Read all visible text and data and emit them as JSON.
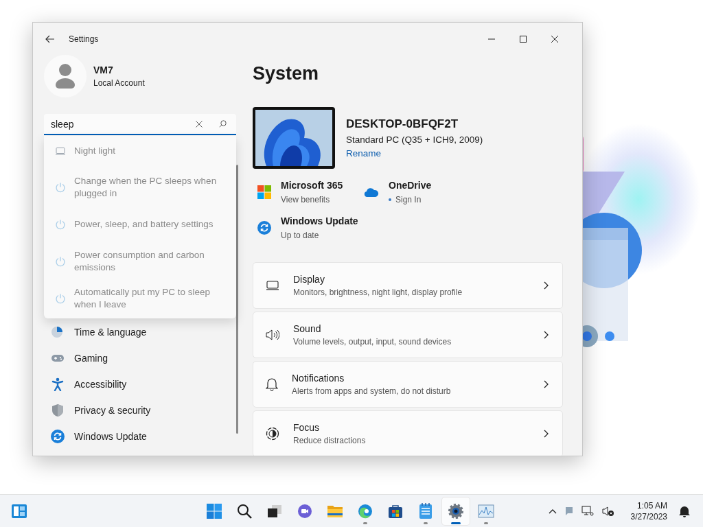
{
  "window": {
    "title": "Settings"
  },
  "account": {
    "name": "VM7",
    "type": "Local Account"
  },
  "search": {
    "value": "sleep"
  },
  "search_results": [
    {
      "kind": "display",
      "label": "Night light"
    },
    {
      "kind": "power",
      "label": "Change when the PC sleeps when plugged in"
    },
    {
      "kind": "power",
      "label": "Power, sleep, and battery settings"
    },
    {
      "kind": "power",
      "label": "Power consumption and carbon emissions"
    },
    {
      "kind": "power",
      "label": "Automatically put my PC to sleep when I leave"
    }
  ],
  "sidebar": {
    "items": [
      {
        "kind": "time",
        "label": "Time & language"
      },
      {
        "kind": "gaming",
        "label": "Gaming"
      },
      {
        "kind": "accessibility",
        "label": "Accessibility"
      },
      {
        "kind": "privacy",
        "label": "Privacy & security"
      },
      {
        "kind": "update",
        "label": "Windows Update"
      }
    ]
  },
  "page": {
    "title": "System"
  },
  "device": {
    "name": "DESKTOP-0BFQF2T",
    "model": "Standard PC (Q35 + ICH9, 2009)",
    "action": "Rename"
  },
  "services": [
    {
      "kind": "m365",
      "title": "Microsoft 365",
      "subtitle": "View benefits"
    },
    {
      "kind": "onedrive",
      "title": "OneDrive",
      "subtitle": "Sign In"
    },
    {
      "kind": "update",
      "title": "Windows Update",
      "subtitle": "Up to date"
    }
  ],
  "categories": [
    {
      "kind": "display",
      "title": "Display",
      "subtitle": "Monitors, brightness, night light, display profile"
    },
    {
      "kind": "sound",
      "title": "Sound",
      "subtitle": "Volume levels, output, input, sound devices"
    },
    {
      "kind": "notifications",
      "title": "Notifications",
      "subtitle": "Alerts from apps and system, do not disturb"
    },
    {
      "kind": "focus",
      "title": "Focus",
      "subtitle": "Reduce distractions"
    }
  ],
  "taskbar": {
    "apps": [
      {
        "kind": "start",
        "running": false,
        "selected": false
      },
      {
        "kind": "search",
        "running": false,
        "selected": false
      },
      {
        "kind": "taskview",
        "running": false,
        "selected": false
      },
      {
        "kind": "chat",
        "running": false,
        "selected": false
      },
      {
        "kind": "explorer",
        "running": false,
        "selected": false
      },
      {
        "kind": "edge",
        "running": true,
        "selected": false
      },
      {
        "kind": "store",
        "running": false,
        "selected": false
      },
      {
        "kind": "notepad",
        "running": true,
        "selected": false
      },
      {
        "kind": "settings",
        "running": true,
        "selected": true
      },
      {
        "kind": "monitor",
        "running": true,
        "selected": false
      }
    ],
    "clock": {
      "time": "1:05 AM",
      "date": "3/27/2023"
    }
  }
}
